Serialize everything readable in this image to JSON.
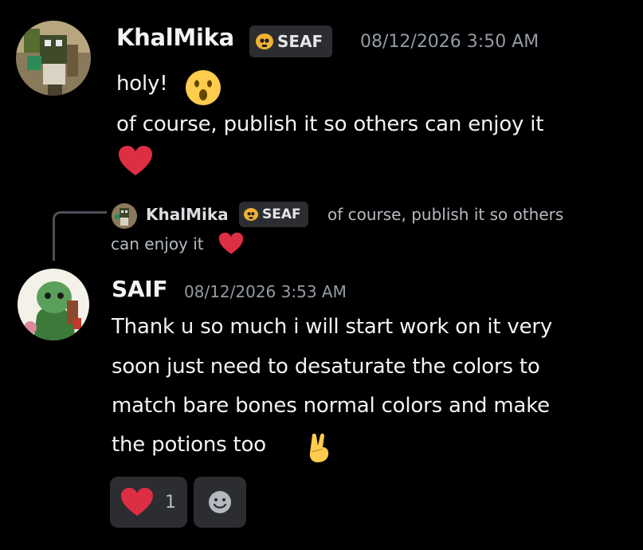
{
  "messages": [
    {
      "author": "KhalMika",
      "tag": "SEAF",
      "timestamp": "08/12/2026 3:50 AM",
      "lines": [
        "holy!",
        "of course, publish it so others can enjoy it"
      ],
      "emojis": [
        "astonished-face",
        "red-heart"
      ]
    },
    {
      "reply": {
        "author": "KhalMika",
        "tag": "SEAF",
        "text_line1": "of course, publish it so others",
        "text_line2": "can enjoy it"
      },
      "author": "SAIF",
      "timestamp": "08/12/2026 3:53 AM",
      "lines": [
        "Thank u so much i will start work on it very",
        "soon just need to desaturate the colors to",
        "match bare bones normal colors and make",
        "the potions too"
      ],
      "emojis": [
        "victory-hand"
      ],
      "reactions": [
        {
          "emoji": "red-heart",
          "count": "1"
        }
      ],
      "add_reaction_icon": "smiley-add-reaction-icon"
    }
  ],
  "colors": {
    "background": "#000000",
    "username": "#f2f3f5",
    "timestamp": "#949ba4",
    "tag_bg": "#2b2d31",
    "skull": "#f0b232",
    "heart": "#dd2e44",
    "reaction_bg": "#2b2d31"
  }
}
